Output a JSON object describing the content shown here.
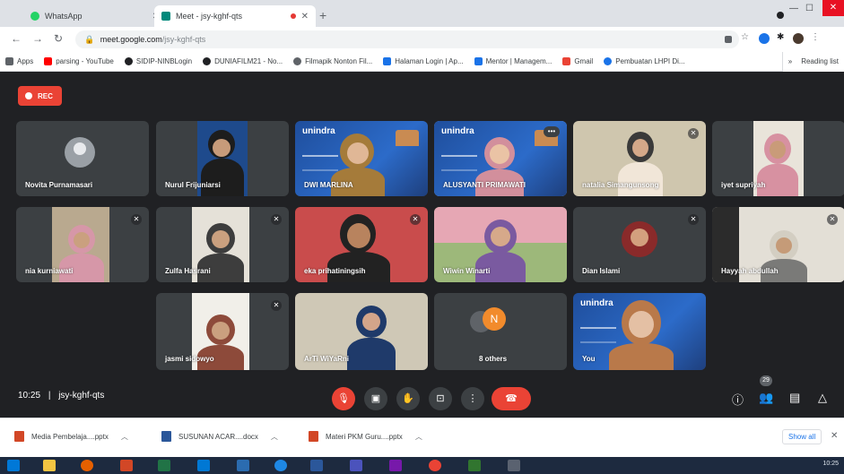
{
  "browser": {
    "tabs": [
      {
        "title": "WhatsApp",
        "active": false
      },
      {
        "title": "Meet - jsy-kghf-qts",
        "active": true
      }
    ],
    "new_tab": "+",
    "address": {
      "host": "meet.google.com",
      "path": "/jsy-kghf-qts"
    },
    "bookmarks": [
      {
        "label": "Apps",
        "icon": "apps-grid-icon",
        "color": "#5f6368"
      },
      {
        "label": "parsing - YouTube",
        "icon": "youtube-icon",
        "color": "#ff0000"
      },
      {
        "label": "SIDIP-NINBLogin",
        "icon": "github-icon",
        "color": "#202124"
      },
      {
        "label": "DUNIAFILM21 - No...",
        "icon": "site-icon",
        "color": "#202124"
      },
      {
        "label": "Filmapik Nonton Fil...",
        "icon": "site-icon",
        "color": "#5f6368"
      },
      {
        "label": "Halaman Login | Ap...",
        "icon": "site-icon",
        "color": "#1a73e8"
      },
      {
        "label": "Mentor | Managem...",
        "icon": "site-icon",
        "color": "#1a73e8"
      },
      {
        "label": "Gmail",
        "icon": "gmail-icon",
        "color": "#ea4335"
      },
      {
        "label": "Pembuatan LHPI Di...",
        "icon": "site-icon",
        "color": "#1a73e8"
      }
    ],
    "bookmarks_more": "»",
    "reading_list": "Reading list"
  },
  "meet": {
    "rec_label": "REC",
    "participants_row1": [
      {
        "name": "Novita Purnamasari",
        "type": "avatar"
      },
      {
        "name": "Nurul Frijuniarsi",
        "type": "video"
      },
      {
        "name": "DWI MARLINA",
        "type": "banner"
      },
      {
        "name": "ALUSYANTI PRIMAWATI",
        "type": "banner",
        "highlight": true
      },
      {
        "name": "natalia Simangunsong",
        "type": "video"
      },
      {
        "name": "iyet supriyah",
        "type": "video"
      }
    ],
    "participants_row2": [
      {
        "name": "nia kurniawati",
        "type": "video"
      },
      {
        "name": "Zulfa Hasrani",
        "type": "video"
      },
      {
        "name": "eka prihatiningsih",
        "type": "video"
      },
      {
        "name": "Wiwin Winarti",
        "type": "video"
      },
      {
        "name": "Dian Islami",
        "type": "avatar"
      },
      {
        "name": "Hayyah abdullah",
        "type": "video"
      }
    ],
    "participants_row3": [
      {
        "name": "jasmi sidowyo",
        "type": "video"
      },
      {
        "name": "ArTi WiYaRni",
        "type": "video"
      },
      {
        "name": "8 others",
        "type": "others"
      },
      {
        "name": "You",
        "type": "banner"
      }
    ],
    "banner_logo": "unindra",
    "others_initial": "N",
    "time": "10:25",
    "separator": "|",
    "meeting_code": "jsy-kghf-qts",
    "participant_count": "29"
  },
  "downloads": [
    {
      "file": "Media Pembelaja....pptx",
      "color": "#d24726"
    },
    {
      "file": "SUSUNAN ACAR....docx",
      "color": "#2b579a"
    },
    {
      "file": "Materi PKM Guru....pptx",
      "color": "#d24726"
    }
  ],
  "downloads_show_all": "Show all",
  "taskbar": {
    "tray": "10:25"
  }
}
